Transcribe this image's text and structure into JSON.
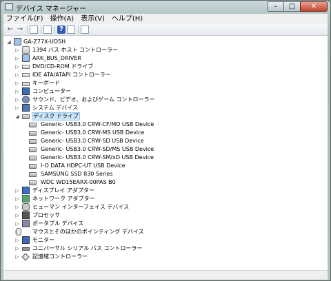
{
  "window": {
    "title": "デバイス マネージャー",
    "caption": {
      "minimize": "–",
      "maximize": "□",
      "close": "✕"
    }
  },
  "menu": [
    {
      "label": "ファイル(F)"
    },
    {
      "label": "操作(A)"
    },
    {
      "label": "表示(V)"
    },
    {
      "label": "ヘルプ(H)"
    }
  ],
  "toolbar": {
    "back": "←",
    "forward": "→",
    "help": "?"
  },
  "tree": {
    "root": "GA-Z77X-UD5H",
    "categories": [
      {
        "label": "1394 バス ホスト コントローラー",
        "icon": "usb-controller-icon"
      },
      {
        "label": "ARK_BUS_DRIVER",
        "icon": "computer-device-icon"
      },
      {
        "label": "DVD/CD-ROM ドライブ",
        "icon": "dvd-drive-icon"
      },
      {
        "label": "IDE ATA/ATAPI コントローラー",
        "icon": "ide-controller-icon"
      },
      {
        "label": "キーボード",
        "icon": "keyboard-icon"
      },
      {
        "label": "コンピューター",
        "icon": "computer-icon"
      },
      {
        "label": "サウンド、ビデオ、およびゲーム コントローラー",
        "icon": "sound-icon"
      },
      {
        "label": "システム デバイス",
        "icon": "system-devices-icon"
      },
      {
        "label": "ディスク ドライブ",
        "icon": "disk-drive-icon",
        "expanded": true
      }
    ],
    "disk_drives": [
      "Generic- USB3.0 CRW-CF/MD USB Device",
      "Generic- USB3.0 CRW-MS USB Device",
      "Generic- USB3.0 CRW-SD USB Device",
      "Generic- USB3.0 CRW-SD/MS USB Device",
      "Generic- USB3.0 CRW-SM/xD USB Device",
      "I-O DATA HDPC-UT USB Device",
      "SAMSUNG SSD 830 Series",
      "WDC WD15EARX-00PAS B0"
    ],
    "categories_after": [
      {
        "label": "ディスプレイ アダプター",
        "icon": "display-adapter-icon"
      },
      {
        "label": "ネットワーク アダプター",
        "icon": "network-adapter-icon"
      },
      {
        "label": "ヒューマン インターフェイス デバイス",
        "icon": "hid-icon"
      },
      {
        "label": "プロセッサ",
        "icon": "processor-icon"
      },
      {
        "label": "ポータブル デバイス",
        "icon": "portable-device-icon"
      },
      {
        "label": "マウスとそのほかのポインティング デバイス",
        "icon": "mouse-icon"
      },
      {
        "label": "モニター",
        "icon": "monitor-icon"
      },
      {
        "label": "ユニバーサル シリアル バス コントローラー",
        "icon": "usb-bus-icon"
      },
      {
        "label": "記憶域コントローラー",
        "icon": "storage-controller-icon"
      }
    ]
  }
}
